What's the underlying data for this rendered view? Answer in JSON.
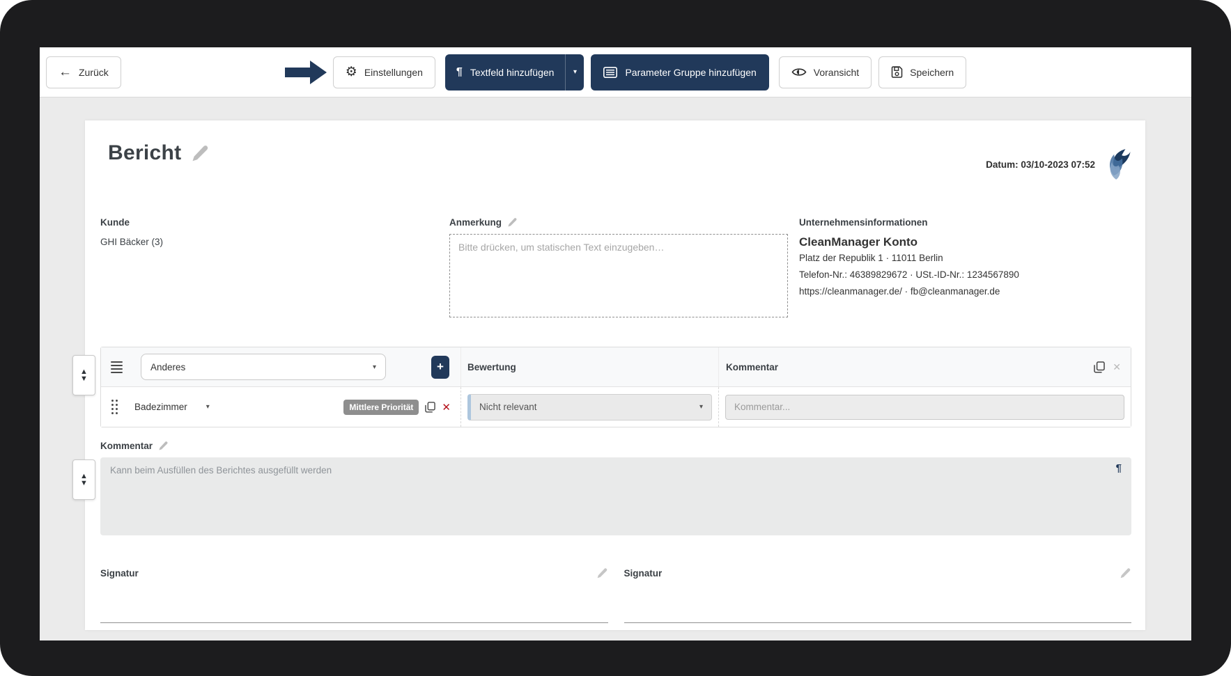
{
  "toolbar": {
    "back": {
      "label": "Zurück",
      "icon": "←"
    },
    "settings": {
      "label": "Einstellungen",
      "icon": "⚙"
    },
    "add_textfield": {
      "label": "Textfeld hinzufügen",
      "icon": "¶",
      "caret": "▾"
    },
    "add_parameter_group": {
      "label": "Parameter Gruppe hinzufügen"
    },
    "preview": {
      "label": "Voransicht"
    },
    "save": {
      "label": "Speichern"
    }
  },
  "report": {
    "title": "Bericht",
    "date": "Datum: 03/10-2023 07:52",
    "customer": {
      "label": "Kunde",
      "value": "GHI Bäcker (3)"
    },
    "note": {
      "label": "Anmerkung",
      "placeholder": "Bitte drücken, um statischen Text einzugeben…"
    },
    "company": {
      "label": "Unternehmensinformationen",
      "name": "CleanManager Konto",
      "address": "Platz der Republik 1 · 11011 Berlin",
      "phone_vat": "Telefon-Nr.: 46389829672 · USt.-ID-Nr.: 1234567890",
      "web_mail": "https://cleanmanager.de/ · fb@cleanmanager.de"
    },
    "group": {
      "type_value": "Anderes",
      "add_icon": "+",
      "col_rating": "Bewertung",
      "col_comment": "Kommentar",
      "row": {
        "parameter": "Badezimmer",
        "priority": "Mittlere Priorität",
        "rating": "Nicht relevant",
        "comment_placeholder": "Kommentar..."
      }
    },
    "comment": {
      "label": "Kommentar",
      "placeholder": "Kann beim Ausfüllen des Berichtes ausgefüllt werden",
      "pilcrow": "¶"
    },
    "signature_left": "Signatur",
    "signature_right": "Signatur"
  },
  "glyphs": {
    "caret": "▾",
    "close": "✕",
    "up": "▲",
    "down": "▼"
  },
  "colors": {
    "navy": "#21395a",
    "badge_gray": "#8e8e8e",
    "danger_red": "#b5121b",
    "page_bg": "#ebebeb",
    "stripe_blue": "#adc6de"
  }
}
